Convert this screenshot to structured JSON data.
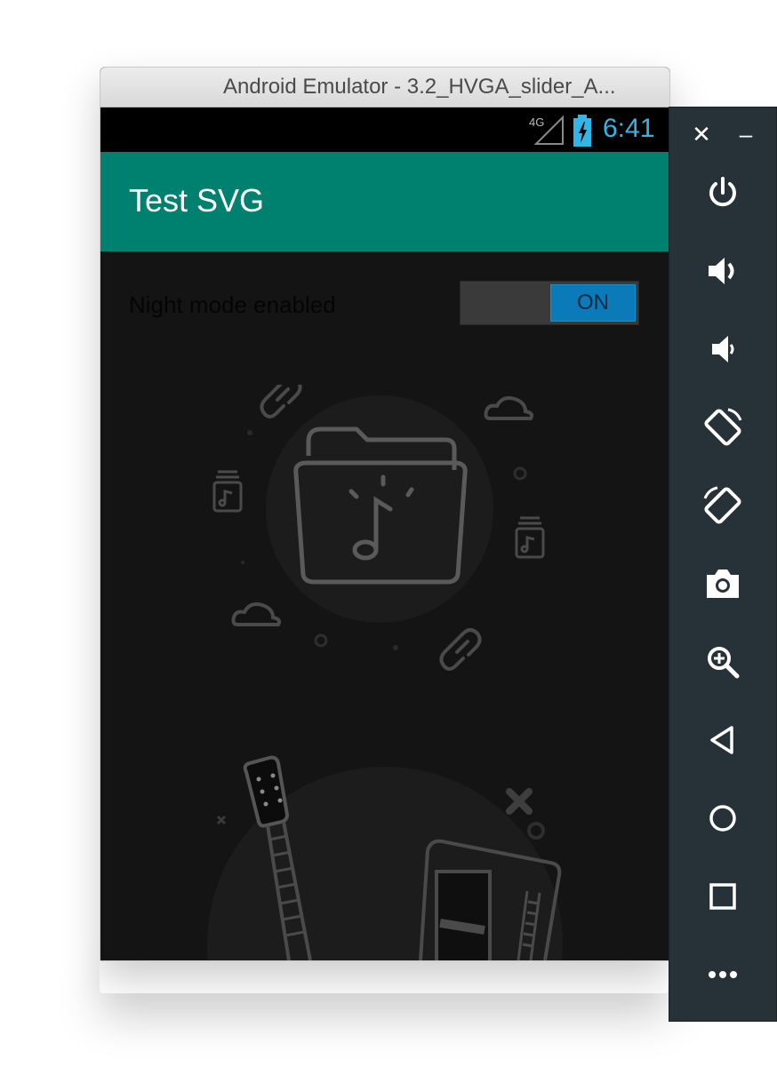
{
  "window": {
    "title": "Android Emulator - 3.2_HVGA_slider_A..."
  },
  "status_bar": {
    "network": "4G",
    "time": "6:41"
  },
  "app_bar": {
    "title": "Test SVG"
  },
  "setting": {
    "label": "Night mode enabled",
    "toggle_state": "ON"
  },
  "sidebar": {
    "buttons": [
      "power-icon",
      "volume-up-icon",
      "volume-down-icon",
      "rotate-left-icon",
      "rotate-right-icon",
      "camera-icon",
      "zoom-icon",
      "back-icon",
      "home-icon",
      "overview-icon",
      "more-icon"
    ]
  },
  "colors": {
    "app_bar": "#00806f",
    "toggle_on": "#0a7ab8",
    "clock": "#33b5e5",
    "sidebar": "#263238",
    "background": "#141414"
  }
}
